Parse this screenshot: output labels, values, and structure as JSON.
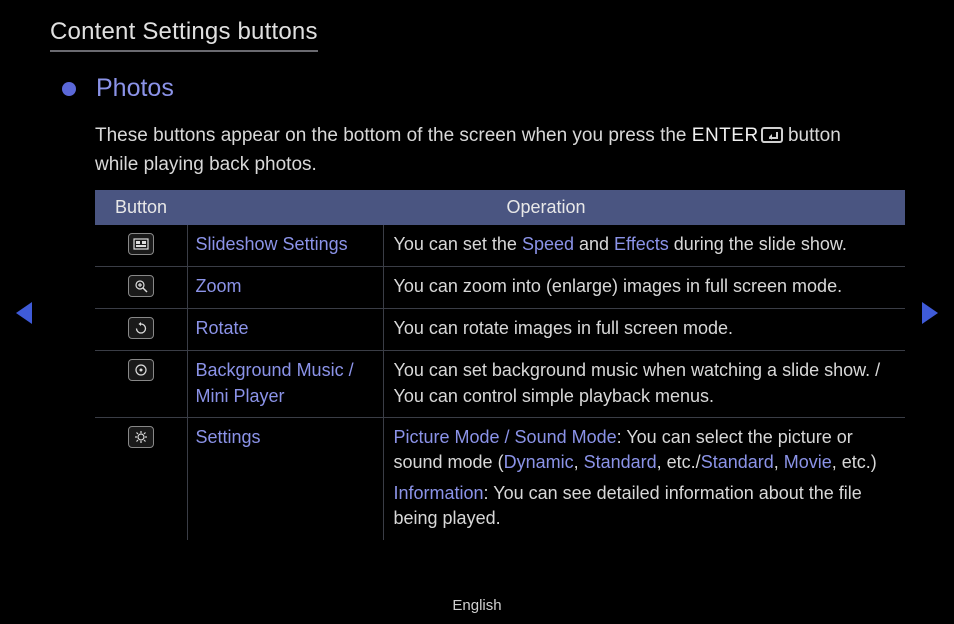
{
  "title": "Content Settings buttons",
  "section": {
    "heading": "Photos",
    "intro_part1": "These buttons appear on the bottom of the screen when you press the ",
    "enter_label": "ENTER",
    "intro_part2": " button while playing back photos."
  },
  "table": {
    "headers": {
      "button": "Button",
      "operation": "Operation"
    },
    "rows": [
      {
        "icon": "slideshow-settings-icon",
        "name": "Slideshow Settings",
        "op_plain_pre": "You can set the ",
        "op_hl1": "Speed",
        "op_mid1": " and ",
        "op_hl2": "Effects",
        "op_plain_post": " during the slide show."
      },
      {
        "icon": "zoom-icon",
        "name": "Zoom",
        "op": "You can zoom into (enlarge) images in full screen mode."
      },
      {
        "icon": "rotate-icon",
        "name": "Rotate",
        "op": "You can rotate images in full screen mode."
      },
      {
        "icon": "music-icon",
        "name": "Background Music / Mini Player",
        "op": "You can set background music when watching a slide show. / You can control simple playback menus."
      },
      {
        "icon": "settings-icon",
        "name": "Settings",
        "line1": {
          "hl1": "Picture Mode / Sound Mode",
          "t1": ": You can select the picture or sound mode (",
          "hl2": "Dynamic",
          "t2": ", ",
          "hl3": "Standard",
          "t3": ", etc./",
          "hl4": "Standard",
          "t4": ", ",
          "hl5": "Movie",
          "t5": ", etc.)"
        },
        "line2": {
          "hl1": "Information",
          "t1": ": You can see detailed information about the file being played."
        }
      }
    ]
  },
  "footer": {
    "language": "English"
  }
}
